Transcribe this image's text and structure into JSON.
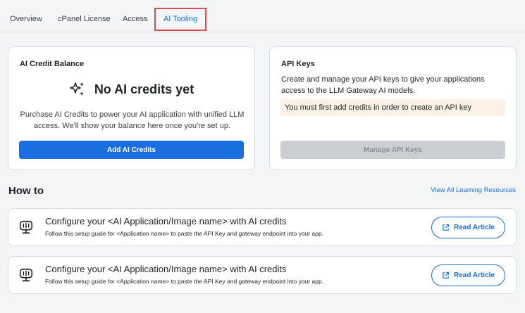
{
  "tabs": [
    {
      "label": "Overview"
    },
    {
      "label": "cPanel License"
    },
    {
      "label": "Access"
    },
    {
      "label": "AI Tooling",
      "active": true
    }
  ],
  "credit_card": {
    "title": "AI Credit Balance",
    "icon": "sparkle-icon",
    "empty_title": "No AI credits yet",
    "description": "Purchase AI Credits to power your AI application with unified LLM access. We'll show your balance here once you're set up.",
    "button_label": "Add AI Credits"
  },
  "api_card": {
    "title": "API Keys",
    "description": "Create and manage your API keys to give your applications access to the LLM Gateway AI models.",
    "warning": "You must first add credits in order to create an API key",
    "button_label": "Manage API Keys"
  },
  "howto": {
    "title": "How to",
    "link_label": "View All Learning Resources",
    "items": [
      {
        "icon": "monitor-icon",
        "title": "Configure your <AI Application/Image name> with AI credits",
        "description": "Follow this setup guide for <Application name> to paste the API Key and gateway endpoint into your app.",
        "button_label": "Read Article"
      },
      {
        "icon": "monitor-icon",
        "title": "Configure your <AI Application/Image name> with AI credits",
        "description": "Follow this setup guide for <Application name> to paste the API Key and gateway endpoint into your app.",
        "button_label": "Read Article"
      }
    ]
  },
  "colors": {
    "accent": "#1a6fe0",
    "active_tab_highlight": "#e0484e",
    "warning_bg": "#fdf1e6",
    "disabled_button": "#cbced3"
  }
}
